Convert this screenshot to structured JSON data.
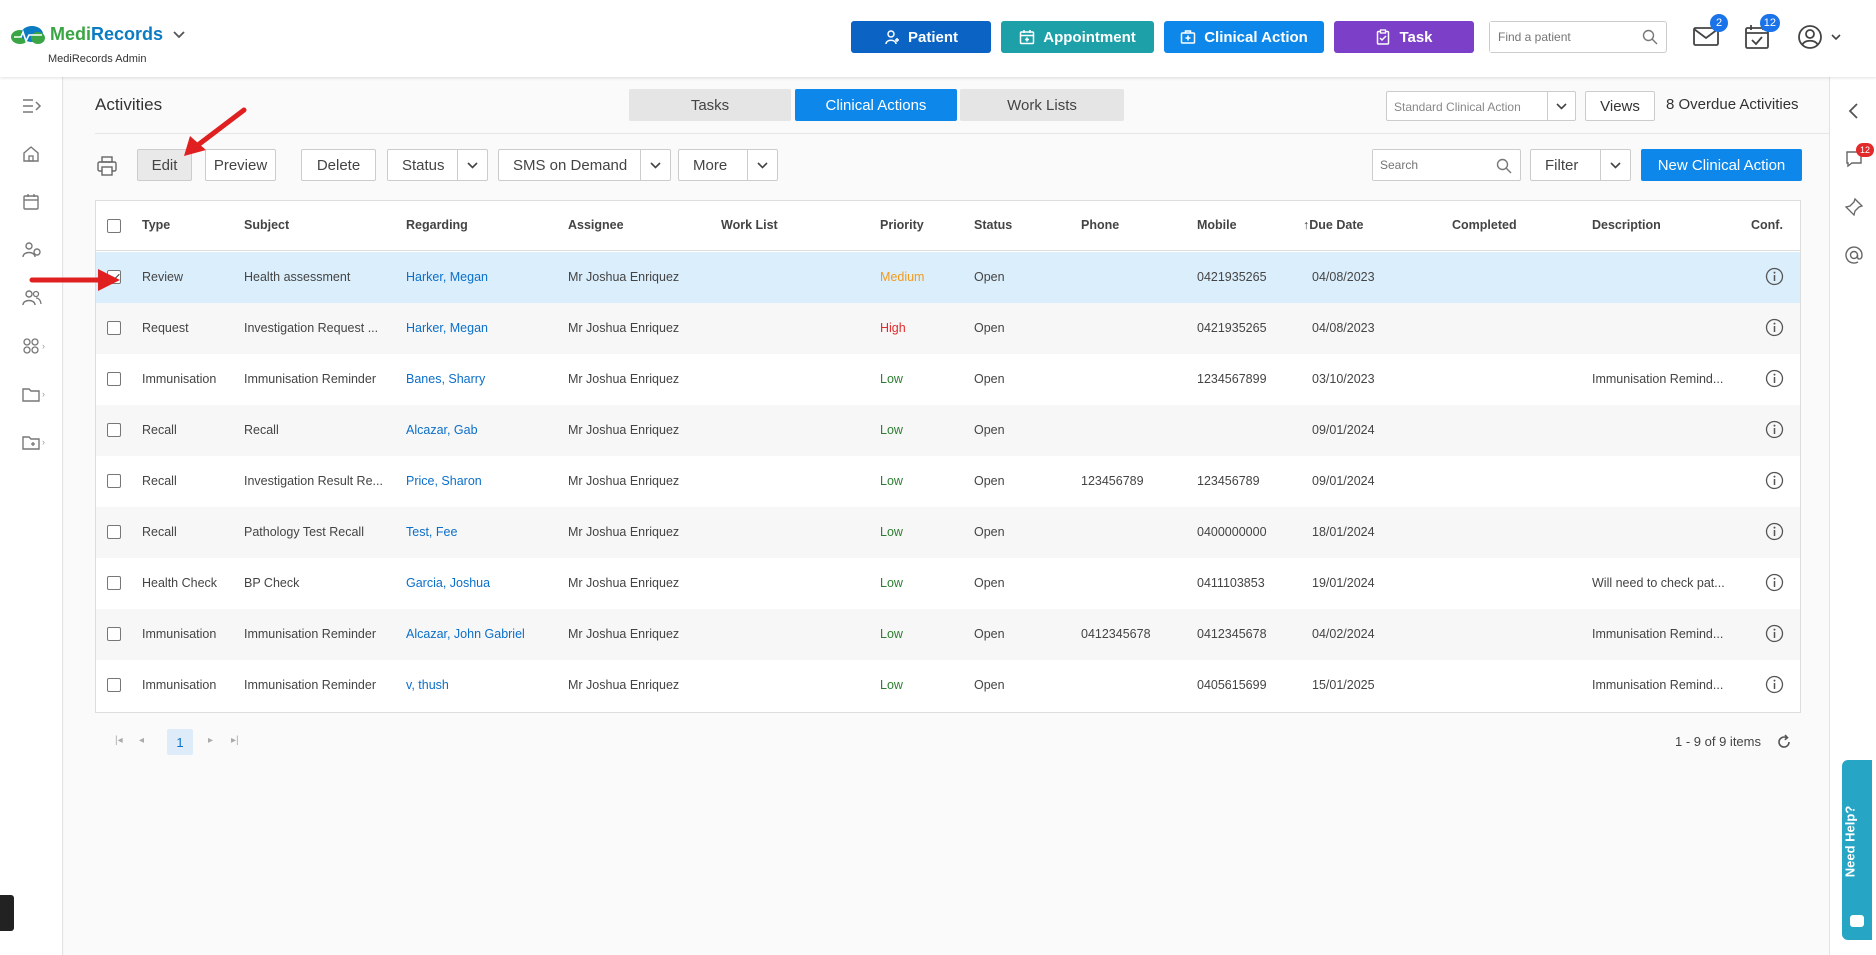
{
  "app": {
    "brand_part1": "Medi",
    "brand_part2": "Records",
    "subtitle": "MediRecords Admin"
  },
  "header": {
    "buttons": [
      {
        "label": "Patient",
        "color": "#0b63c4",
        "icon": "add-user-icon"
      },
      {
        "label": "Appointment",
        "color": "#1ea0a8",
        "icon": "calendar-add-icon"
      },
      {
        "label": "Clinical Action",
        "color": "#0d87e9",
        "icon": "medkit-icon"
      },
      {
        "label": "Task",
        "color": "#7c3fc7",
        "icon": "clipboard-icon"
      }
    ],
    "find_placeholder": "Find a patient",
    "mail_badge": "2",
    "calendar_badge": "12"
  },
  "page": {
    "title": "Activities",
    "tabs": [
      "Tasks",
      "Clinical Actions",
      "Work Lists"
    ],
    "active_tab": "Clinical Actions",
    "view_select": "Standard Clinical Action",
    "views_label": "Views",
    "overdue": "8 Overdue Activities"
  },
  "toolbar": {
    "edit": "Edit",
    "preview": "Preview",
    "delete": "Delete",
    "status": "Status",
    "sms": "SMS on Demand",
    "more": "More",
    "search_placeholder": "Search",
    "filter": "Filter",
    "new": "New Clinical Action"
  },
  "table": {
    "columns": [
      "Type",
      "Subject",
      "Regarding",
      "Assignee",
      "Work List",
      "Priority",
      "Status",
      "Phone",
      "Mobile",
      "Due Date",
      "Completed",
      "Description",
      "Conf."
    ],
    "rows": [
      {
        "type": "Review",
        "subject": "Health assessment",
        "regarding": "Harker, Megan",
        "assignee": "Mr Joshua Enriquez",
        "worklist": "",
        "priority": "Medium",
        "status": "Open",
        "phone": "",
        "mobile": "0421935265",
        "due": "04/08/2023",
        "completed": "",
        "description": "",
        "checked": true
      },
      {
        "type": "Request",
        "subject": "Investigation Request ...",
        "regarding": "Harker, Megan",
        "assignee": "Mr Joshua Enriquez",
        "worklist": "",
        "priority": "High",
        "status": "Open",
        "phone": "",
        "mobile": "0421935265",
        "due": "04/08/2023",
        "completed": "",
        "description": "",
        "checked": false
      },
      {
        "type": "Immunisation",
        "subject": "Immunisation Reminder",
        "regarding": "Banes, Sharry",
        "assignee": "Mr Joshua Enriquez",
        "worklist": "",
        "priority": "Low",
        "status": "Open",
        "phone": "",
        "mobile": "1234567899",
        "due": "03/10/2023",
        "completed": "",
        "description": "Immunisation Remind...",
        "checked": false
      },
      {
        "type": "Recall",
        "subject": "Recall",
        "regarding": "Alcazar, Gab",
        "assignee": "Mr Joshua Enriquez",
        "worklist": "",
        "priority": "Low",
        "status": "Open",
        "phone": "",
        "mobile": "",
        "due": "09/01/2024",
        "completed": "",
        "description": "",
        "checked": false
      },
      {
        "type": "Recall",
        "subject": "Investigation Result Re...",
        "regarding": "Price, Sharon",
        "assignee": "Mr Joshua Enriquez",
        "worklist": "",
        "priority": "Low",
        "status": "Open",
        "phone": "123456789",
        "mobile": "123456789",
        "due": "09/01/2024",
        "completed": "",
        "description": "",
        "checked": false
      },
      {
        "type": "Recall",
        "subject": "Pathology Test Recall",
        "regarding": "Test, Fee",
        "assignee": "Mr Joshua Enriquez",
        "worklist": "",
        "priority": "Low",
        "status": "Open",
        "phone": "",
        "mobile": "0400000000",
        "due": "18/01/2024",
        "completed": "",
        "description": "",
        "checked": false
      },
      {
        "type": "Health Check",
        "subject": "BP Check",
        "regarding": "Garcia, Joshua",
        "assignee": "Mr Joshua Enriquez",
        "worklist": "",
        "priority": "Low",
        "status": "Open",
        "phone": "",
        "mobile": "0411103853",
        "due": "19/01/2024",
        "completed": "",
        "description": "Will need to check pat...",
        "checked": false
      },
      {
        "type": "Immunisation",
        "subject": "Immunisation Reminder",
        "regarding": "Alcazar, John Gabriel",
        "assignee": "Mr Joshua Enriquez",
        "worklist": "",
        "priority": "Low",
        "status": "Open",
        "phone": "0412345678",
        "mobile": "0412345678",
        "due": "04/02/2024",
        "completed": "",
        "description": "Immunisation Remind...",
        "checked": false
      },
      {
        "type": "Immunisation",
        "subject": "Immunisation Reminder",
        "regarding": "v, thush",
        "assignee": "Mr Joshua Enriquez",
        "worklist": "",
        "priority": "Low",
        "status": "Open",
        "phone": "",
        "mobile": "0405615699",
        "due": "15/01/2025",
        "completed": "",
        "description": "Immunisation Remind...",
        "checked": false
      }
    ]
  },
  "pager": {
    "current": "1",
    "summary": "1 - 9 of 9 items"
  },
  "help_label": "Need Help?",
  "chat_badge": "12"
}
